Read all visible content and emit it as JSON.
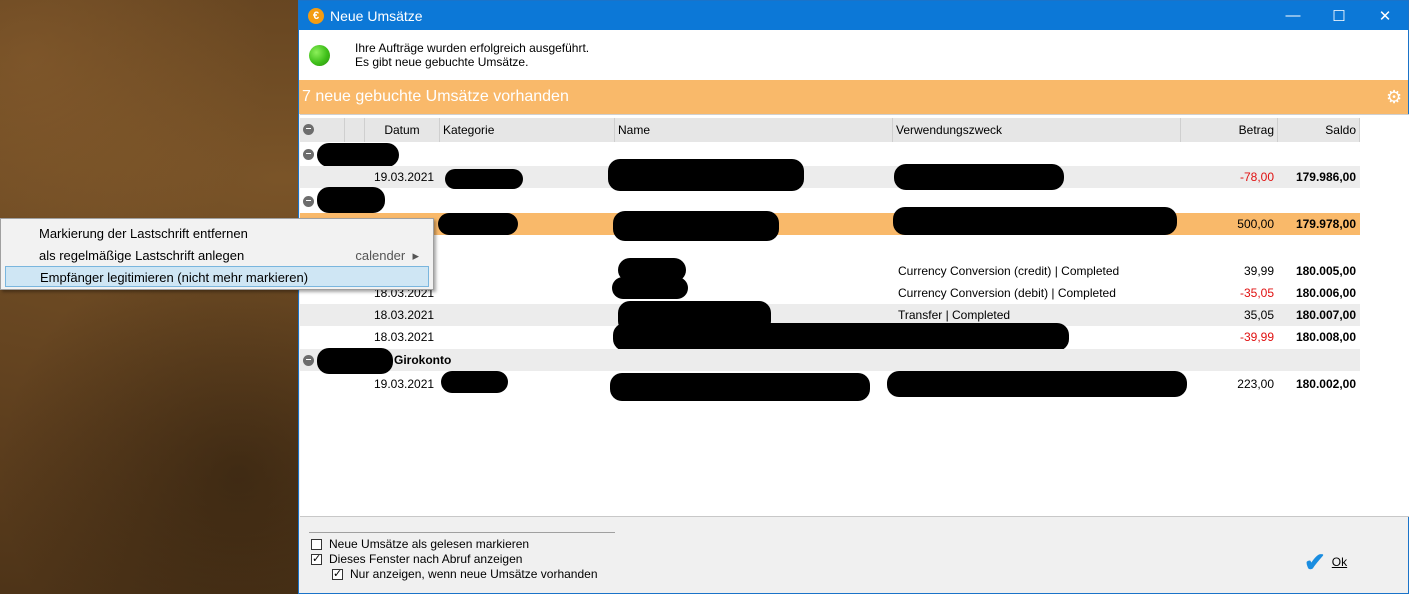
{
  "window": {
    "title": "Neue Umsätze",
    "icon": "euro-icon",
    "controls": [
      "minimize",
      "maximize",
      "close"
    ]
  },
  "status": {
    "line1": "Ihre Aufträge wurden erfolgreich ausgeführt.",
    "line2": "Es gibt neue gebuchte Umsätze.",
    "indicator_color": "#3fbf1a"
  },
  "banner": {
    "text": "7 neue gebuchte Umsätze vorhanden",
    "color": "#f9b96a"
  },
  "table": {
    "columns": [
      "Datum",
      "Kategorie",
      "Name",
      "Verwendungszweck",
      "Betrag",
      "Saldo"
    ],
    "group_3_label": "Girokonto",
    "rows": [
      {
        "datum": "19.03.2021",
        "kategorie": "",
        "name": "",
        "zweck": "",
        "betrag": "-78,00",
        "saldo": "179.986,00",
        "negative": true
      },
      {
        "datum": "",
        "kategorie": "",
        "name": "",
        "zweck": "",
        "betrag": "500,00",
        "saldo": "179.978,00",
        "negative": false,
        "selected": true
      },
      {
        "datum": "",
        "kategorie": "",
        "name": "",
        "zweck": "Currency Conversion (credit) | Completed",
        "betrag": "39,99",
        "saldo": "180.005,00",
        "negative": false
      },
      {
        "datum": "18.03.2021",
        "kategorie": "",
        "name": "",
        "zweck": "Currency Conversion (debit) | Completed",
        "betrag": "-35,05",
        "saldo": "180.006,00",
        "negative": true
      },
      {
        "datum": "18.03.2021",
        "kategorie": "",
        "name": "",
        "zweck": "Transfer | Completed",
        "betrag": "35,05",
        "saldo": "180.007,00",
        "negative": false
      },
      {
        "datum": "18.03.2021",
        "kategorie": "",
        "name": "",
        "zweck": "",
        "betrag": "-39,99",
        "saldo": "180.008,00",
        "negative": true
      },
      {
        "datum": "19.03.2021",
        "kategorie": "",
        "name": "",
        "zweck": "",
        "betrag": "223,00",
        "saldo": "180.002,00",
        "negative": false
      }
    ]
  },
  "footer": {
    "cb1": {
      "label": "Neue Umsätze als gelesen markieren",
      "checked": false
    },
    "cb2": {
      "label": "Dieses Fenster nach Abruf anzeigen",
      "checked": true
    },
    "cb3": {
      "label": "Nur anzeigen, wenn neue Umsätze vorhanden",
      "checked": true
    },
    "ok_label": "Ok"
  },
  "context_menu": {
    "items": [
      {
        "label": "Markierung der Lastschrift entfernen"
      },
      {
        "label": "als regelmäßige Lastschrift anlegen",
        "submenu": "calender"
      },
      {
        "label": "Empfänger legitimieren (nicht mehr markieren)",
        "highlighted": true
      }
    ]
  }
}
